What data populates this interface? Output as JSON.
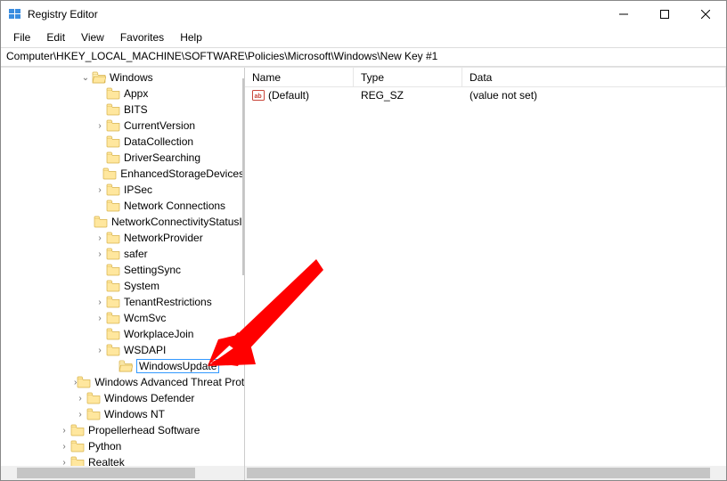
{
  "window": {
    "title": "Registry Editor"
  },
  "menu": {
    "file": "File",
    "edit": "Edit",
    "view": "View",
    "favorites": "Favorites",
    "help": "Help"
  },
  "address": "Computer\\HKEY_LOCAL_MACHINE\\SOFTWARE\\Policies\\Microsoft\\Windows\\New Key #1",
  "tree": {
    "windows": "Windows",
    "items": [
      "Appx",
      "BITS",
      "CurrentVersion",
      "DataCollection",
      "DriverSearching",
      "EnhancedStorageDevices",
      "IPSec",
      "Network Connections",
      "NetworkConnectivityStatusIndicator",
      "NetworkProvider",
      "safer",
      "SettingSync",
      "System",
      "TenantRestrictions",
      "WcmSvc",
      "WorkplaceJoin",
      "WSDAPI"
    ],
    "editing": "WindowsUpdate",
    "siblings": [
      "Windows Advanced Threat Protection",
      "Windows Defender",
      "Windows NT"
    ],
    "parents": [
      "Propellerhead Software",
      "Python",
      "Realtek"
    ]
  },
  "list": {
    "headers": {
      "name": "Name",
      "type": "Type",
      "data": "Data"
    },
    "rows": [
      {
        "name": "(Default)",
        "type": "REG_SZ",
        "data": "(value not set)"
      }
    ]
  }
}
